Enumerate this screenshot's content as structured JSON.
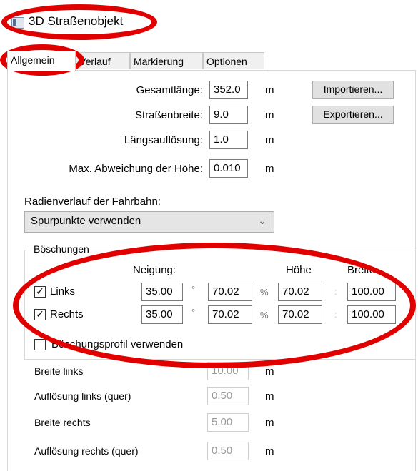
{
  "window": {
    "title": "3D Straßenobjekt",
    "icon": "window-app-icon"
  },
  "tabs": [
    {
      "label": "Allgemein",
      "active": true
    },
    {
      "label": "Verlauf",
      "active": false
    },
    {
      "label": "Markierung",
      "active": false
    },
    {
      "label": "Optionen",
      "active": false
    }
  ],
  "general": {
    "gesamtlaenge": {
      "label": "Gesamtlänge:",
      "value": "352.0",
      "unit": "m"
    },
    "strassenbreite": {
      "label": "Straßenbreite:",
      "value": "9.0",
      "unit": "m"
    },
    "laengsaufloesung": {
      "label": "Längsauflösung:",
      "value": "1.0",
      "unit": "m"
    },
    "max_abweichung": {
      "label": "Max. Abweichung der Höhe:",
      "value": "0.010",
      "unit": "m"
    },
    "import_button": "Importieren...",
    "export_button": "Exportieren..."
  },
  "radius": {
    "label": "Radienverlauf der Fahrbahn:",
    "selected": "Spurpunkte verwenden"
  },
  "boeschungen": {
    "title": "Böschungen",
    "col_neigung": "Neigung:",
    "col_hoehe": "Höhe",
    "col_breite": "Breite",
    "rows": [
      {
        "label": "Links",
        "checked": true,
        "neigung_deg": "35.00",
        "deg_unit": "°",
        "neigung_pct": "70.02",
        "pct_unit": "%",
        "hoehe": "70.02",
        "colon": ":",
        "breite": "100.00"
      },
      {
        "label": "Rechts",
        "checked": true,
        "neigung_deg": "35.00",
        "deg_unit": "°",
        "neigung_pct": "70.02",
        "pct_unit": "%",
        "hoehe": "70.02",
        "colon": ":",
        "breite": "100.00"
      }
    ],
    "profil_label": "Böschungsprofil verwenden",
    "profil_checked": false
  },
  "profile_fields": [
    {
      "label": "Breite links",
      "value": "10.00",
      "unit": "m"
    },
    {
      "label": "Auflösung links (quer)",
      "value": "0.50",
      "unit": "m"
    },
    {
      "label": "Breite rechts",
      "value": "5.00",
      "unit": "m"
    },
    {
      "label": "Auflösung rechts (quer)",
      "value": "0.50",
      "unit": "m"
    }
  ],
  "colors": {
    "highlight_ring": "#e10000",
    "disabled_text": "#9a9a9a"
  }
}
